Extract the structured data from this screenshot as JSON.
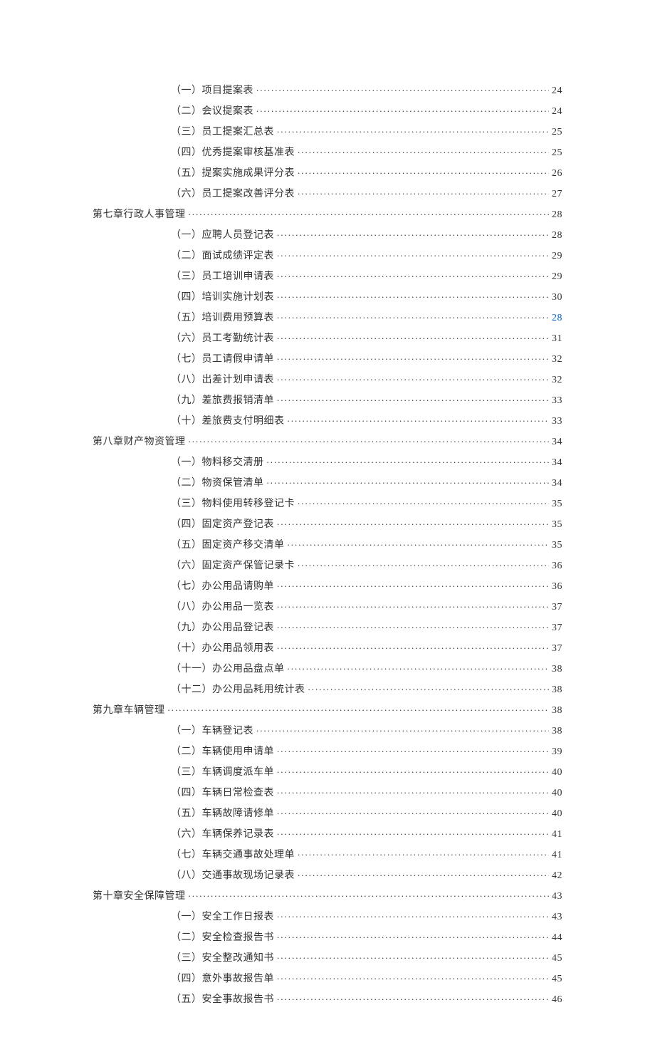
{
  "toc": [
    {
      "indent": 2,
      "label": "（一）项目提案表",
      "page": "24",
      "link": false
    },
    {
      "indent": 2,
      "label": "（二）会议提案表",
      "page": "24",
      "link": false
    },
    {
      "indent": 2,
      "label": "（三）员工提案汇总表",
      "page": "25",
      "link": false
    },
    {
      "indent": 2,
      "label": "（四）优秀提案审核基准表",
      "page": "25",
      "link": false
    },
    {
      "indent": 2,
      "label": "（五）提案实施成果评分表",
      "page": "26",
      "link": false
    },
    {
      "indent": 2,
      "label": "（六）员工提案改善评分表",
      "page": "27",
      "link": false
    },
    {
      "indent": 1,
      "label": "第七章行政人事管理",
      "page": "28",
      "link": false
    },
    {
      "indent": 2,
      "label": "（一）应聘人员登记表",
      "page": "28",
      "link": false
    },
    {
      "indent": 2,
      "label": "（二）面试成绩评定表",
      "page": "29",
      "link": false
    },
    {
      "indent": 2,
      "label": "（三）员工培训申请表",
      "page": "29",
      "link": false
    },
    {
      "indent": 2,
      "label": "（四）培训实施计划表",
      "page": "30",
      "link": false
    },
    {
      "indent": 2,
      "label": "（五）培训费用预算表",
      "page": "28",
      "link": true
    },
    {
      "indent": 2,
      "label": "（六）员工考勤统计表",
      "page": "31",
      "link": false
    },
    {
      "indent": 2,
      "label": "（七）员工请假申请单",
      "page": "32",
      "link": false
    },
    {
      "indent": 2,
      "label": "（八）出差计划申请表",
      "page": "32",
      "link": false
    },
    {
      "indent": 2,
      "label": "（九）差旅费报销清单",
      "page": "33",
      "link": false
    },
    {
      "indent": 2,
      "label": "（十）差旅费支付明细表",
      "page": "33",
      "link": false
    },
    {
      "indent": 1,
      "label": "第八章财产物资管理",
      "page": "34",
      "link": false
    },
    {
      "indent": 2,
      "label": "（一）物料移交清册",
      "page": "34",
      "link": false
    },
    {
      "indent": 2,
      "label": "（二）物资保管清单",
      "page": "34",
      "link": false
    },
    {
      "indent": 2,
      "label": "（三）物料使用转移登记卡",
      "page": "35",
      "link": false
    },
    {
      "indent": 2,
      "label": "（四）固定资产登记表",
      "page": "35",
      "link": false
    },
    {
      "indent": 2,
      "label": "（五）固定资产移交清单",
      "page": "35",
      "link": false
    },
    {
      "indent": 2,
      "label": "（六）固定资产保管记录卡",
      "page": "36",
      "link": false
    },
    {
      "indent": 2,
      "label": "（七）办公用品请购单",
      "page": "36",
      "link": false
    },
    {
      "indent": 2,
      "label": "（八）办公用品一览表",
      "page": "37",
      "link": false
    },
    {
      "indent": 2,
      "label": "（九）办公用品登记表",
      "page": "37",
      "link": false
    },
    {
      "indent": 2,
      "label": "（十）办公用品领用表",
      "page": "37",
      "link": false
    },
    {
      "indent": 2,
      "label": "（十一）办公用品盘点单",
      "page": "38",
      "link": false
    },
    {
      "indent": 2,
      "label": "（十二）办公用品耗用统计表",
      "page": "38",
      "link": false
    },
    {
      "indent": 1,
      "label": "第九章车辆管理",
      "page": "38",
      "link": false
    },
    {
      "indent": 2,
      "label": "（一）车辆登记表",
      "page": "38",
      "link": false
    },
    {
      "indent": 2,
      "label": "（二）车辆使用申请单",
      "page": "39",
      "link": false
    },
    {
      "indent": 2,
      "label": "（三）车辆调度派车单",
      "page": "40",
      "link": false
    },
    {
      "indent": 2,
      "label": "（四）车辆日常检查表",
      "page": "40",
      "link": false
    },
    {
      "indent": 2,
      "label": "（五）车辆故障请修单",
      "page": "40",
      "link": false
    },
    {
      "indent": 2,
      "label": "（六）车辆保养记录表",
      "page": "41",
      "link": false
    },
    {
      "indent": 2,
      "label": "（七）车辆交通事故处理单",
      "page": "41",
      "link": false
    },
    {
      "indent": 2,
      "label": "（八）交通事故现场记录表",
      "page": "42",
      "link": false
    },
    {
      "indent": 1,
      "label": "第十章安全保障管理",
      "page": "43",
      "link": false
    },
    {
      "indent": 2,
      "label": "（一）安全工作日报表",
      "page": "43",
      "link": false
    },
    {
      "indent": 2,
      "label": "（二）安全检查报告书",
      "page": "44",
      "link": false
    },
    {
      "indent": 2,
      "label": "（三）安全整改通知书",
      "page": "45",
      "link": false
    },
    {
      "indent": 2,
      "label": "（四）意外事故报告单",
      "page": "45",
      "link": false
    },
    {
      "indent": 2,
      "label": "（五）安全事故报告书",
      "page": "46",
      "link": false
    }
  ]
}
